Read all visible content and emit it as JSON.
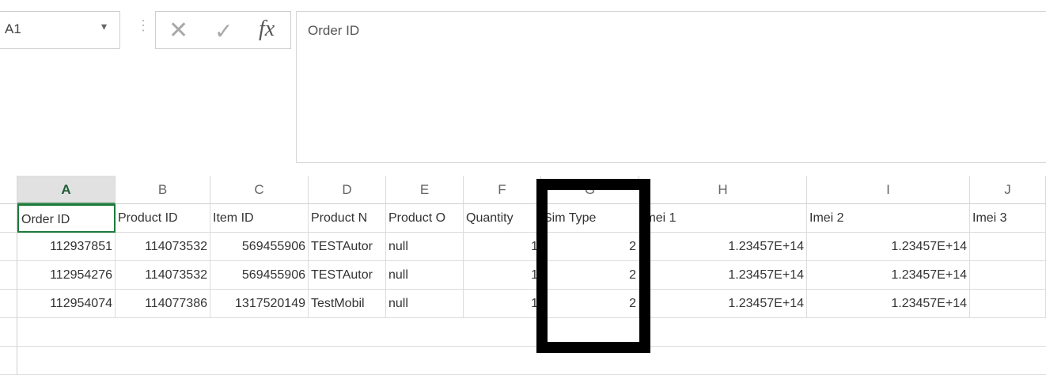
{
  "formula_bar": {
    "name_box": "A1",
    "cancel_icon": "✕",
    "enter_icon": "✓",
    "fx_label": "fx",
    "content": "Order ID"
  },
  "columns": [
    "A",
    "B",
    "C",
    "D",
    "E",
    "F",
    "G",
    "H",
    "I",
    "J"
  ],
  "sheet": {
    "header_row": [
      "Order ID",
      "Product ID",
      "Item ID",
      "Product N",
      "Product O",
      "Quantity",
      "Sim Type",
      "Imei 1",
      "Imei 2",
      "Imei 3"
    ],
    "rows": [
      [
        "112937851",
        "114073532",
        "569455906",
        "TESTAutor",
        "null",
        "1",
        "2",
        "1.23457E+14",
        "1.23457E+14",
        ""
      ],
      [
        "112954276",
        "114073532",
        "569455906",
        "TESTAutor",
        "null",
        "1",
        "2",
        "1.23457E+14",
        "1.23457E+14",
        ""
      ],
      [
        "112954074",
        "114077386",
        "1317520149",
        "TestMobil",
        "null",
        "1",
        "2",
        "1.23457E+14",
        "1.23457E+14",
        ""
      ]
    ]
  },
  "annotation": {
    "highlight_color": "#000000",
    "target_column": "G"
  }
}
